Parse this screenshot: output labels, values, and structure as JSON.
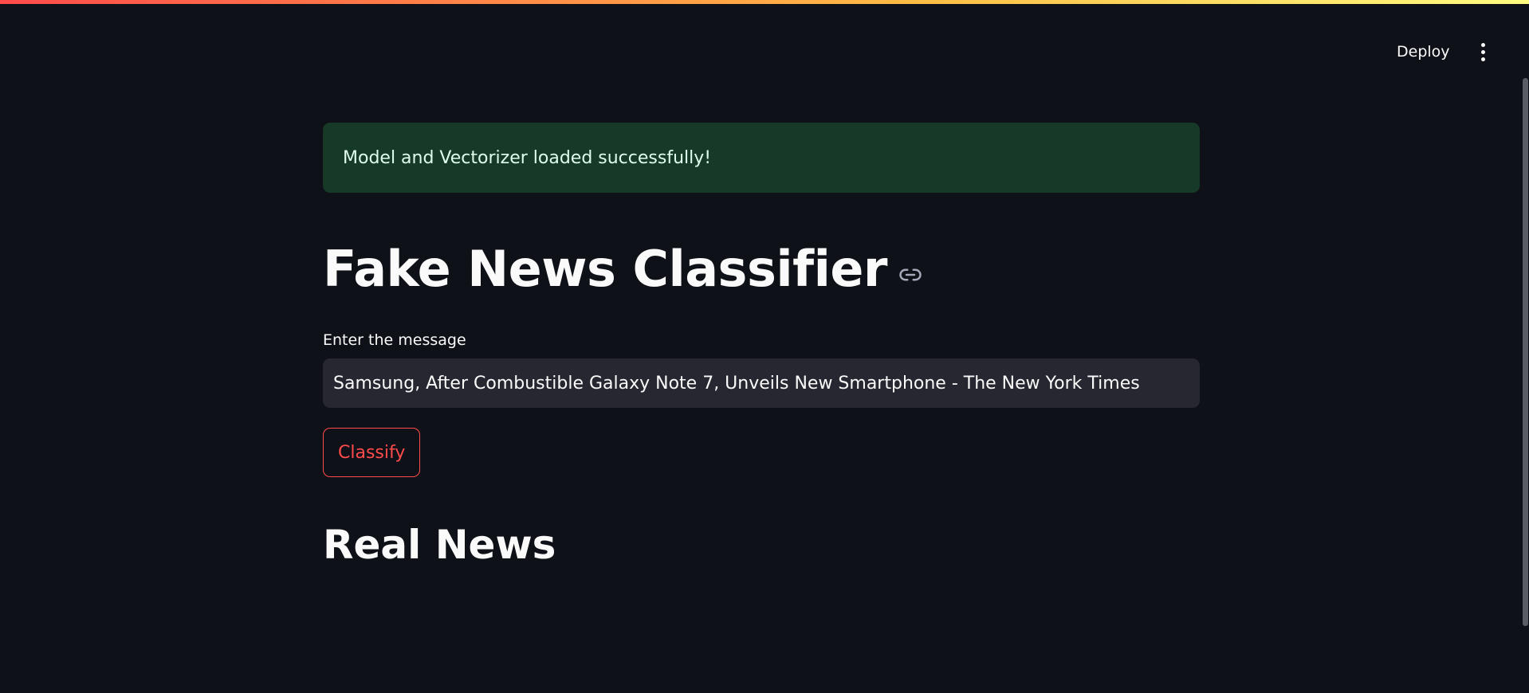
{
  "header": {
    "deploy_label": "Deploy",
    "menu_icon": "more-vertical-icon"
  },
  "main": {
    "success_message": "Model and Vectorizer loaded successfully!",
    "title": "Fake News Classifier",
    "title_link_icon": "link-icon",
    "input": {
      "label": "Enter the message",
      "value": "Samsung, After Combustible Galaxy Note 7, Unveils New Smartphone - The New York Times"
    },
    "classify_label": "Classify",
    "result": "Real News"
  },
  "colors": {
    "background": "#0e1117",
    "accent": "#ff4b4b",
    "success_bg": "#173928",
    "success_text": "#dffde9",
    "input_bg": "#262730"
  }
}
